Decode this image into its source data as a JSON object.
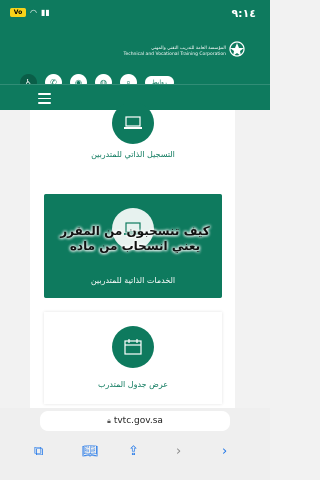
{
  "status_bar": {
    "time": "٩:١٤",
    "battery": "Vo"
  },
  "header": {
    "org_name_ar": "المؤسسة العامة للتدريب التقني والمهني",
    "org_name_en": "Technical and Vocational Training Corporation",
    "links_label": "روابط"
  },
  "cards": [
    {
      "label": "التسجيل الذاتي للمتدربين",
      "icon": "laptop-icon"
    },
    {
      "label": "الخدمات الذاتية للمتدربين",
      "icon": "laptop-icon"
    },
    {
      "label": "عرض جدول المتدرب",
      "icon": "calendar-icon"
    }
  ],
  "caption": {
    "line1": "كيف تنسحبون من المقرر",
    "line2": "يعني انسحاب من ماده"
  },
  "browser": {
    "url": "tvtc.gov.sa"
  },
  "colors": {
    "brand": "#0e7a5e"
  }
}
